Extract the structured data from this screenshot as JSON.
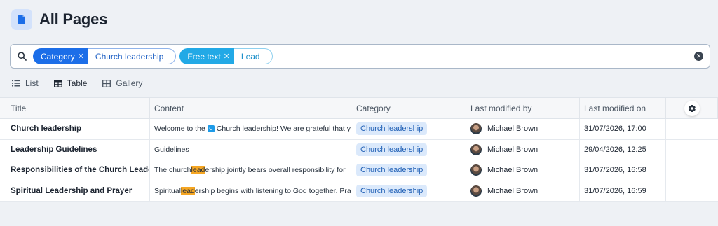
{
  "header": {
    "title": "All Pages",
    "icon": "document-icon"
  },
  "search": {
    "filters": [
      {
        "key": "Category",
        "value": "Church leadership",
        "color": "#1c6ee8"
      },
      {
        "key": "Free text",
        "value": "Lead",
        "color": "#22a9e6"
      }
    ]
  },
  "views": [
    {
      "label": "List",
      "icon": "list-icon",
      "active": false
    },
    {
      "label": "Table",
      "icon": "table-icon",
      "active": true
    },
    {
      "label": "Gallery",
      "icon": "gallery-icon",
      "active": false
    }
  ],
  "table": {
    "columns": [
      "Title",
      "Content",
      "Category",
      "Last modified by",
      "Last modified on"
    ],
    "rows": [
      {
        "title": "Church leadership",
        "content": {
          "pre": "Welcome to the ",
          "link_icon": "C",
          "link": "Church leadership",
          "post": "! We are grateful that y"
        },
        "category": "Church leadership",
        "modified_by": "Michael Brown",
        "modified_on": "31/07/2026, 17:00"
      },
      {
        "title": "Leadership Guidelines",
        "content": {
          "pre": "Guidelines",
          "hl": "",
          "post": ""
        },
        "category": "Church leadership",
        "modified_by": "Michael Brown",
        "modified_on": "29/04/2026, 12:25"
      },
      {
        "title": "Responsibilities of the Church Leadersl",
        "content": {
          "pre": "The church ",
          "hl": "lead",
          "post": "ership jointly bears overall responsibility for"
        },
        "category": "Church leadership",
        "modified_by": "Michael Brown",
        "modified_on": "31/07/2026, 16:58"
      },
      {
        "title": "Spiritual Leadership and Prayer",
        "content": {
          "pre": "Spiritual ",
          "hl": "lead",
          "post": "ership begins with listening to God together. Pra"
        },
        "category": "Church leadership",
        "modified_by": "Michael Brown",
        "modified_on": "31/07/2026, 16:59"
      }
    ]
  }
}
